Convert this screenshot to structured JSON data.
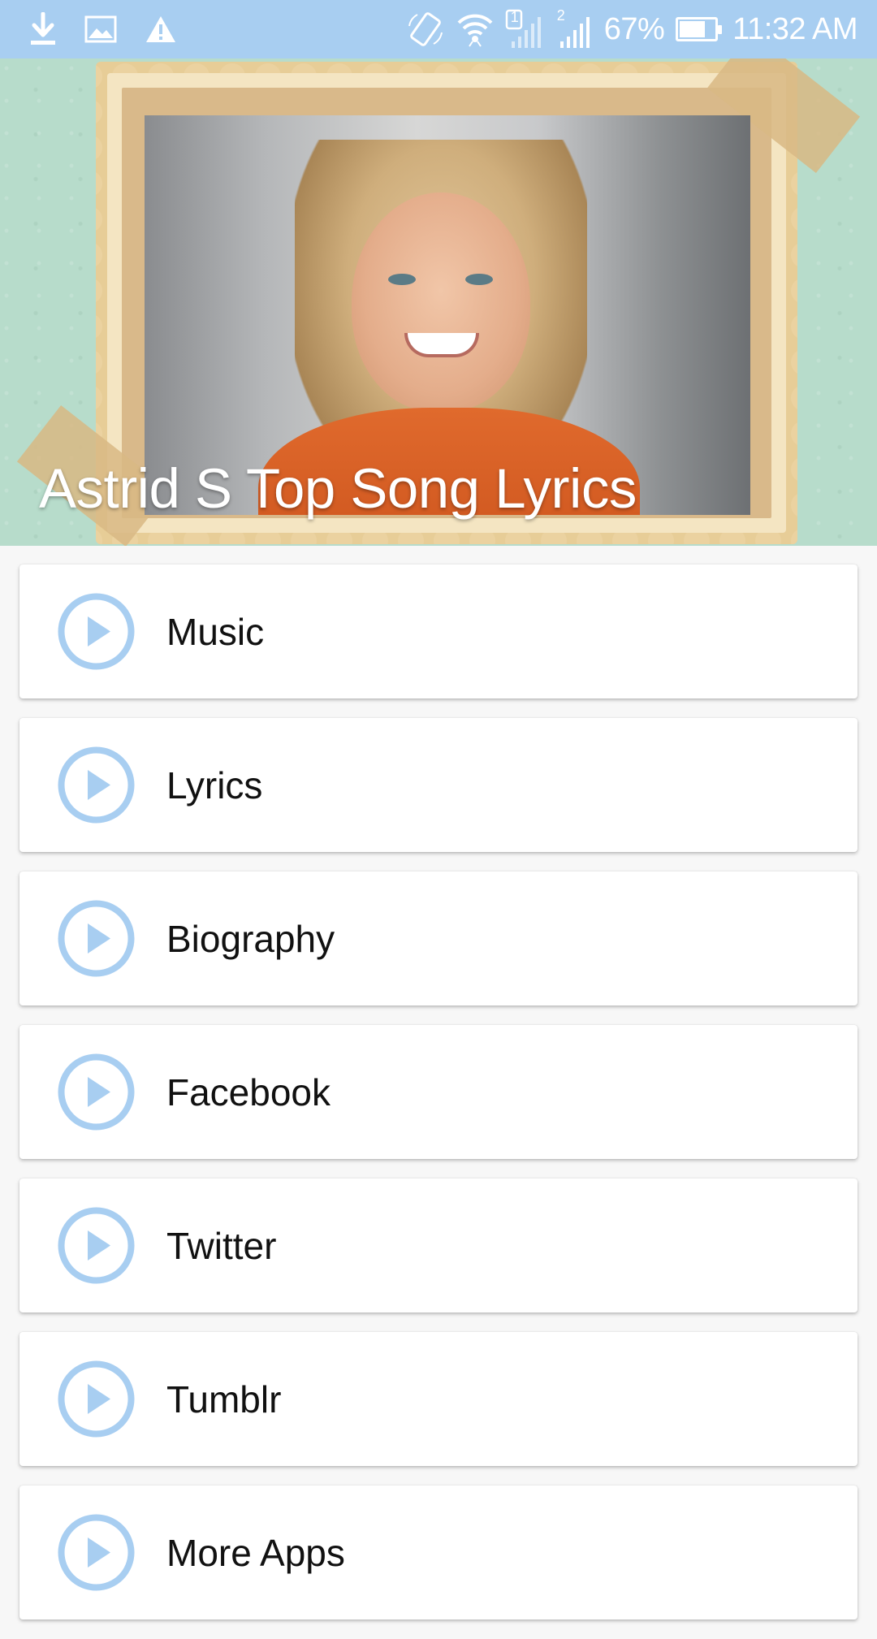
{
  "status_bar": {
    "left_icons": [
      "download-icon",
      "image-icon",
      "warning-icon"
    ],
    "right_icons": [
      "screen-rotate-icon",
      "wifi-icon",
      "signal-sim1-icon",
      "signal-sim2-icon"
    ],
    "sim1_label": "1",
    "sim2_label": "2",
    "battery_percent": "67%",
    "battery_level": 0.67,
    "time": "11:32 AM"
  },
  "header": {
    "title": "Astrid S Top Song Lyrics"
  },
  "menu": {
    "icon": "play-circle-icon",
    "accent_color": "#a8cef1",
    "items": [
      {
        "label": "Music"
      },
      {
        "label": "Lyrics"
      },
      {
        "label": "Biography"
      },
      {
        "label": "Facebook"
      },
      {
        "label": "Twitter"
      },
      {
        "label": "Tumblr"
      },
      {
        "label": "More Apps"
      }
    ]
  }
}
